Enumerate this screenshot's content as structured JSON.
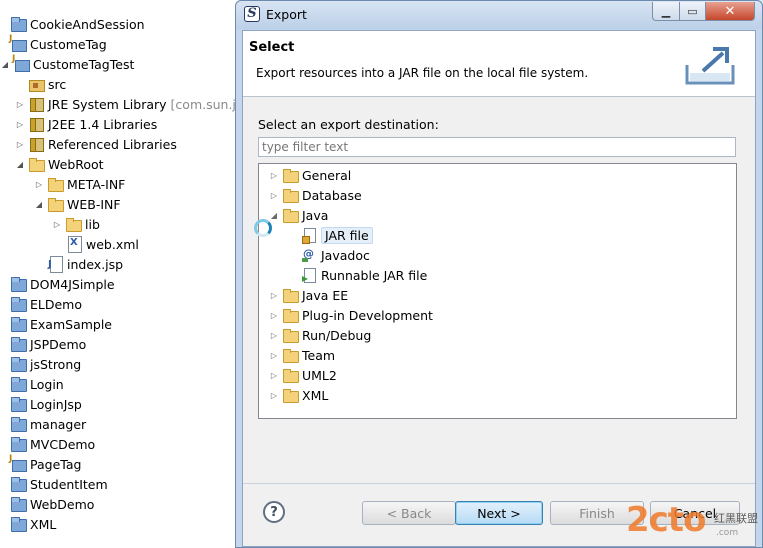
{
  "explorer": {
    "rows": [
      {
        "label": "CookieAndSession"
      },
      {
        "label": "CustomeTag"
      },
      {
        "label": "CustomeTagTest"
      },
      {
        "label": "src"
      },
      {
        "label": "JRE System Library",
        "extra": "[com.sun.java"
      },
      {
        "label": "J2EE 1.4 Libraries"
      },
      {
        "label": "Referenced Libraries"
      },
      {
        "label": "WebRoot"
      },
      {
        "label": "META-INF"
      },
      {
        "label": "WEB-INF"
      },
      {
        "label": "lib"
      },
      {
        "label": "web.xml"
      },
      {
        "label": "index.jsp"
      },
      {
        "label": "DOM4JSimple"
      },
      {
        "label": "ELDemo"
      },
      {
        "label": "ExamSample"
      },
      {
        "label": "JSPDemo"
      },
      {
        "label": "jsStrong"
      },
      {
        "label": "Login"
      },
      {
        "label": "LoginJsp"
      },
      {
        "label": "manager"
      },
      {
        "label": "MVCDemo"
      },
      {
        "label": "PageTag"
      },
      {
        "label": "StudentItem"
      },
      {
        "label": "WebDemo"
      },
      {
        "label": "XML"
      }
    ]
  },
  "dialog": {
    "title": "Export",
    "header_title": "Select",
    "header_desc": "Export resources into a JAR file on the local file system.",
    "destination_label": "Select an export destination:",
    "filter_placeholder": "type filter text",
    "tree": [
      {
        "label": "General"
      },
      {
        "label": "Database"
      },
      {
        "label": "Java"
      },
      {
        "label": "JAR file"
      },
      {
        "label": "Javadoc"
      },
      {
        "label": "Runnable JAR file"
      },
      {
        "label": "Java EE"
      },
      {
        "label": "Plug-in Development"
      },
      {
        "label": "Run/Debug"
      },
      {
        "label": "Team"
      },
      {
        "label": "UML2"
      },
      {
        "label": "XML"
      }
    ],
    "buttons": {
      "help": "?",
      "back": "< Back",
      "next": "Next >",
      "finish": "Finish",
      "cancel": "Cancel"
    }
  },
  "watermark": {
    "logo": "2cto",
    "text": "红黑联盟",
    "sub": ".com"
  },
  "colors": {
    "accent": "#3c7fb1",
    "selection": "#e5eff9",
    "close_button": "#c5462c",
    "watermark": "#ef7a2a"
  }
}
